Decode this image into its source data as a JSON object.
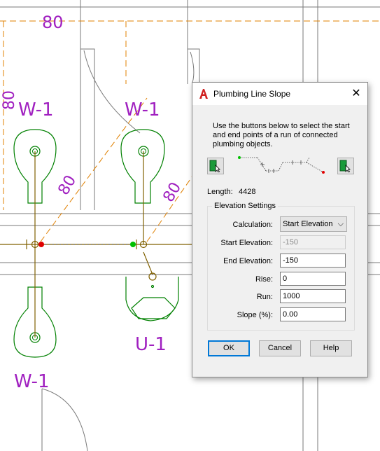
{
  "drawing": {
    "dimension_text": "80",
    "diagonal_dims": [
      "80",
      "80"
    ],
    "vertical_dim": "80",
    "fixture_labels": [
      "W-1",
      "W-1",
      "W-1",
      "U-1"
    ]
  },
  "dialog": {
    "title": "Plumbing Line Slope",
    "description": "Use the buttons below to select the start and end points of a run of connected plumbing objects.",
    "length_label": "Length:",
    "length_value": "4428",
    "group_title": "Elevation Settings",
    "calculation": {
      "label": "Calculation:",
      "value": "Start Elevation"
    },
    "start_elevation": {
      "label": "Start Elevation:",
      "value": "-150"
    },
    "end_elevation": {
      "label": "End Elevation:",
      "value": "-150"
    },
    "rise": {
      "label": "Rise:",
      "value": "0"
    },
    "run": {
      "label": "Run:",
      "value": "1000"
    },
    "slope": {
      "label": "Slope (%):",
      "value": "0.00"
    },
    "buttons": {
      "ok": "OK",
      "cancel": "Cancel",
      "help": "Help"
    },
    "icons": {
      "app": "autocad-a-icon",
      "close": "close-icon",
      "pick_start": "pick-point-icon",
      "pick_end": "pick-point-icon"
    }
  },
  "colors": {
    "pipe": "#806000",
    "fixture": "#008000",
    "dim": "#e08000",
    "label": "#a020c0",
    "start_marker": "#00c000",
    "end_marker": "#e00000",
    "accent": "#0078d7"
  }
}
